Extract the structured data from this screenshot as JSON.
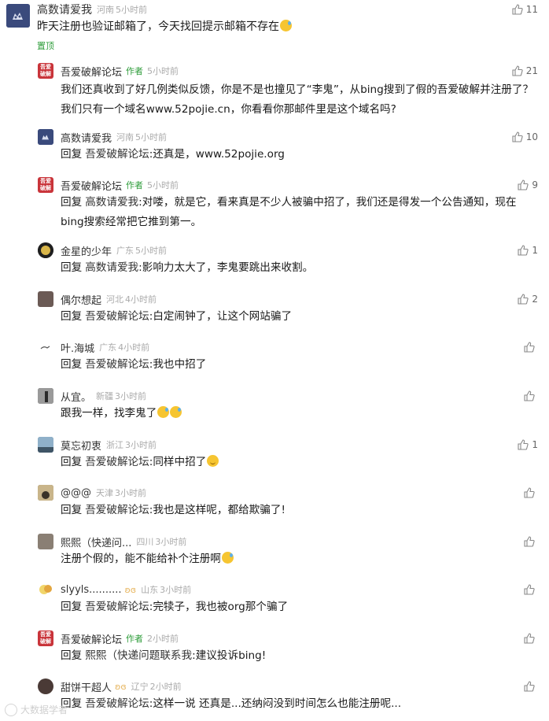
{
  "labels": {
    "reply": "回复",
    "author_badge": "作者",
    "pinned": "置顶",
    "colon": ":"
  },
  "comments": [
    {
      "username": "高数请爱我",
      "location": "河南",
      "time": "5小时前",
      "likes": "11",
      "content": "昨天注册也验证邮箱了，今天找回提示邮箱不存在",
      "avatar_icon": "cat-avatar-icon",
      "avatar_color": "#3a4a7c"
    },
    {
      "username": "吾爱破解论坛",
      "location": "",
      "time": "5小时前",
      "likes": "21",
      "content": "我们还真收到了好几例类似反馈，你是不是也撞见了“李鬼”，从bing搜到了假的吾爱破解并注册了？我们只有一个域名www.52pojie.cn，你看看你那邮件里是这个域名吗?",
      "avatar_text": "吾爱破解",
      "avatar_color": "#c9343a"
    },
    {
      "username": "高数请爱我",
      "location": "河南",
      "time": "5小时前",
      "likes": "10",
      "reply_to": "吾爱破解论坛",
      "content": "还真是，www.52pojie.org",
      "avatar_color": "#3a4a7c"
    },
    {
      "username": "吾爱破解论坛",
      "location": "",
      "time": "5小时前",
      "likes": "9",
      "reply_to": "高数请爱我",
      "content": "对喽，就是它，看来真是不少人被骗中招了，我们还是得发一个公告通知，现在bing搜索经常把它推到第一。",
      "avatar_text": "吾爱破解",
      "avatar_color": "#c9343a"
    },
    {
      "username": "金星的少年",
      "location": "广东",
      "time": "5小时前",
      "likes": "1",
      "reply_to": "高数请爱我",
      "content": "影响力太大了，李鬼要跳出来收割。",
      "avatar_color": "#1f1f1f"
    },
    {
      "username": "偶尔想起",
      "location": "河北",
      "time": "4小时前",
      "likes": "2",
      "reply_to": "吾爱破解论坛",
      "content": "白定闹钟了，让这个网站骗了",
      "avatar_color": "#6b5a55"
    },
    {
      "username": "叶.海城",
      "location": "广东",
      "time": "4小时前",
      "likes": "",
      "reply_to": "吾爱破解论坛",
      "content": "我也中招了",
      "avatar_color": "#ffffff"
    },
    {
      "username": "从宜。",
      "location": "新疆",
      "time": "3小时前",
      "likes": "",
      "content": "跟我一样，找李鬼了",
      "avatar_color": "#4a4a4a"
    },
    {
      "username": "莫忘初衷",
      "location": "浙江",
      "time": "3小时前",
      "likes": "1",
      "reply_to": "吾爱破解论坛",
      "content": "同样中招了",
      "avatar_color": "#5f7d94"
    },
    {
      "username": "@@@",
      "location": "天津",
      "time": "3小时前",
      "likes": "",
      "reply_to": "吾爱破解论坛",
      "content": "我也是这样呢，都给欺骗了!",
      "avatar_color": "#7b6a4c"
    },
    {
      "username": "熙熙（快递问...",
      "location": "四川",
      "time": "3小时前",
      "likes": "",
      "content": "注册个假的，能不能给补个注册啊",
      "avatar_color": "#8a7f74"
    },
    {
      "username": "slyyls..........",
      "location": "山东",
      "time": "3小时前",
      "likes": "",
      "reply_to": "吾爱破解论坛",
      "content": "完犊子，我也被org那个骗了",
      "avatar_color": "#f1e3a6"
    },
    {
      "username": "吾爱破解论坛",
      "location": "",
      "time": "2小时前",
      "likes": "",
      "reply_to": "熙熙（快递问题联系我",
      "content": "建议投诉bing!",
      "avatar_text": "吾爱破解",
      "avatar_color": "#c9343a"
    },
    {
      "username": "甜饼干超人",
      "location": "辽宁",
      "time": "2小时前",
      "likes": "",
      "reply_to": "吾爱破解论坛",
      "content": "这样一说 还真是...还纳闷没到时间怎么也能注册呢...",
      "avatar_color": "#4a3a36"
    }
  ],
  "watermark": "大数据学者"
}
